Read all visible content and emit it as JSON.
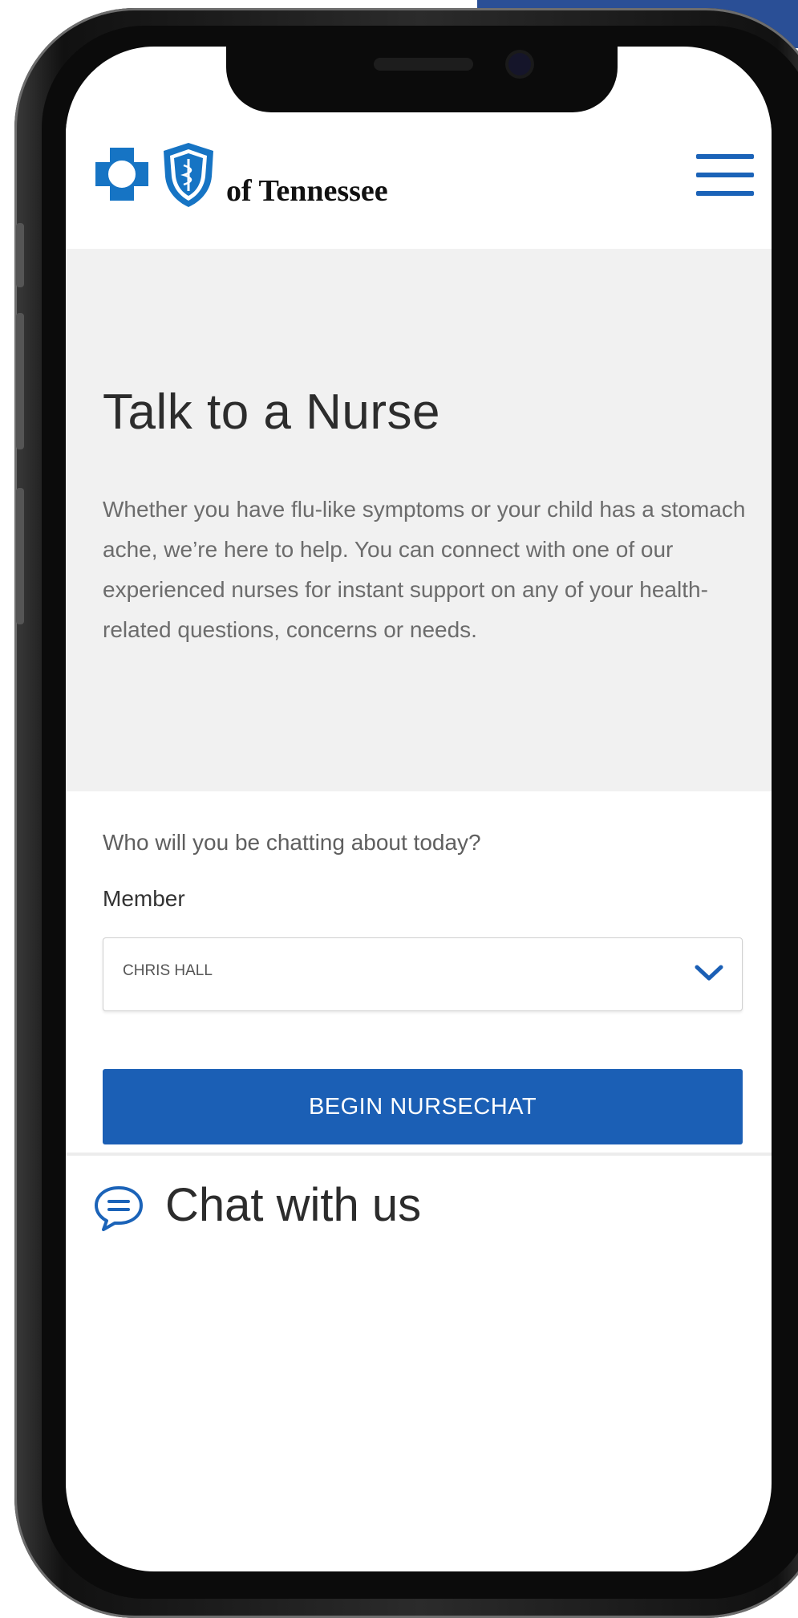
{
  "header": {
    "brand_text": "of Tennessee"
  },
  "hero": {
    "title": "Talk to a Nurse",
    "description": "Whether you have flu-like symptoms or your child has a stomach ache, we’re here to help. You can connect with one of our experienced nurses for instant support on any of your health-related questions, concerns or needs."
  },
  "form": {
    "question": "Who will you be chatting about today?",
    "member_label": "Member",
    "member_selected": "CHRIS HALL",
    "submit_label": "BEGIN NURSECHAT"
  },
  "chat": {
    "label": "Chat with us",
    "icon": "chat-bubble-icon"
  },
  "colors": {
    "brand_blue": "#1b5fb5",
    "hero_background": "#f1f1f1",
    "accent_corner": "#2a4f96"
  }
}
